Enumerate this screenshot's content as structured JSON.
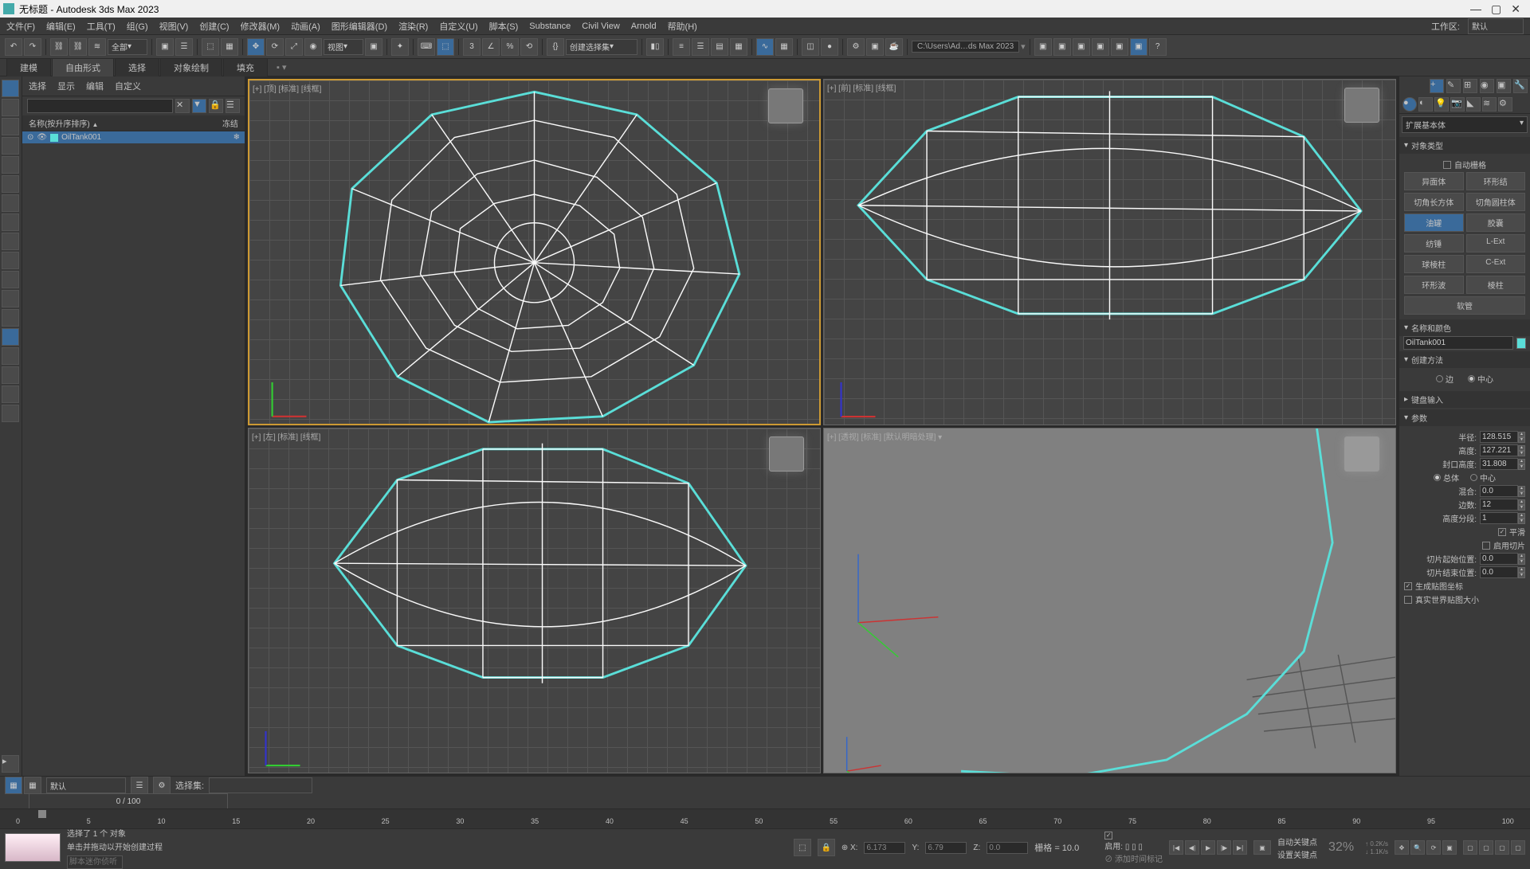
{
  "title": "无标题 - Autodesk 3ds Max 2023",
  "menu": [
    "文件(F)",
    "编辑(E)",
    "工具(T)",
    "组(G)",
    "视图(V)",
    "创建(C)",
    "修改器(M)",
    "动画(A)",
    "图形编辑器(D)",
    "渲染(R)",
    "自定义(U)",
    "脚本(S)",
    "Substance",
    "Civil View",
    "Arnold",
    "帮助(H)"
  ],
  "workspace_label": "工作区:",
  "workspace_value": "默认",
  "toolbar": {
    "filter": "全部",
    "view": "视图",
    "selset": "创建选择集",
    "path": "C:\\Users\\Ad…ds Max 2023"
  },
  "ribbon": [
    "建模",
    "自由形式",
    "选择",
    "对象绘制",
    "填充"
  ],
  "ribbon_active": 1,
  "scene": {
    "tabs": [
      "选择",
      "显示",
      "编辑",
      "自定义"
    ],
    "col_name": "名称(按升序排序)",
    "col_frozen": "冻结",
    "item": "OilTank001"
  },
  "viewports": {
    "top": "[+] [顶] [标准] [线框]",
    "front": "[+] [前] [标准] [线框]",
    "left": "[+] [左] [标准] [线框]",
    "persp": "[+] [透视] [标准] [默认明暗处理] ▾"
  },
  "cmd": {
    "category": "扩展基本体",
    "roll_objtype": "对象类型",
    "autogrid": "自动栅格",
    "types": [
      "异面体",
      "环形结",
      "切角长方体",
      "切角圆柱体",
      "油罐",
      "胶囊",
      "纺锤",
      "L-Ext",
      "球棱柱",
      "C-Ext",
      "环形波",
      "棱柱",
      "软管"
    ],
    "type_hl": 4,
    "roll_namecolor": "名称和颜色",
    "name_value": "OilTank001",
    "roll_create": "创建方法",
    "create_edge": "边",
    "create_center": "中心",
    "roll_kbd": "键盘输入",
    "roll_params": "参数",
    "p_radius": "半径:",
    "v_radius": "128.515",
    "p_height": "高度:",
    "v_height": "127.221",
    "p_cap": "封口高度:",
    "v_cap": "31.808",
    "p_overall": "总体",
    "p_centers": "中心",
    "p_blend": "混合:",
    "v_blend": "0.0",
    "p_sides": "边数:",
    "v_sides": "12",
    "p_hseg": "高度分段:",
    "v_hseg": "1",
    "chk_smooth": "平滑",
    "chk_slice": "启用切片",
    "p_sfrom": "切片起始位置:",
    "v_sfrom": "0.0",
    "p_sto": "切片结束位置:",
    "v_sto": "0.0",
    "chk_genmap": "生成贴图坐标",
    "chk_realworld": "真实世界贴图大小"
  },
  "status": {
    "default": "默认",
    "selset_label": "选择集:",
    "frames": "0  /  100",
    "sel": "选择了 1 个 对象",
    "prompt": "单击并拖动以开始创建过程",
    "scriptph": "脚本迷你侦听",
    "x": "6.173",
    "y": "6.79",
    "z": "0.0",
    "grid": "栅格 = 10.0",
    "enable": "启用:",
    "addtime": "添加时间标记",
    "autokey": "自动关键点",
    "setkey": "设置关键点",
    "pct": "32%",
    "rate1": "0.2K/s",
    "rate2": "1.1K/s"
  },
  "ticks": [
    "0",
    "5",
    "10",
    "15",
    "20",
    "25",
    "30",
    "35",
    "40",
    "45",
    "50",
    "55",
    "60",
    "65",
    "70",
    "75",
    "80",
    "85",
    "90",
    "95",
    "100"
  ]
}
